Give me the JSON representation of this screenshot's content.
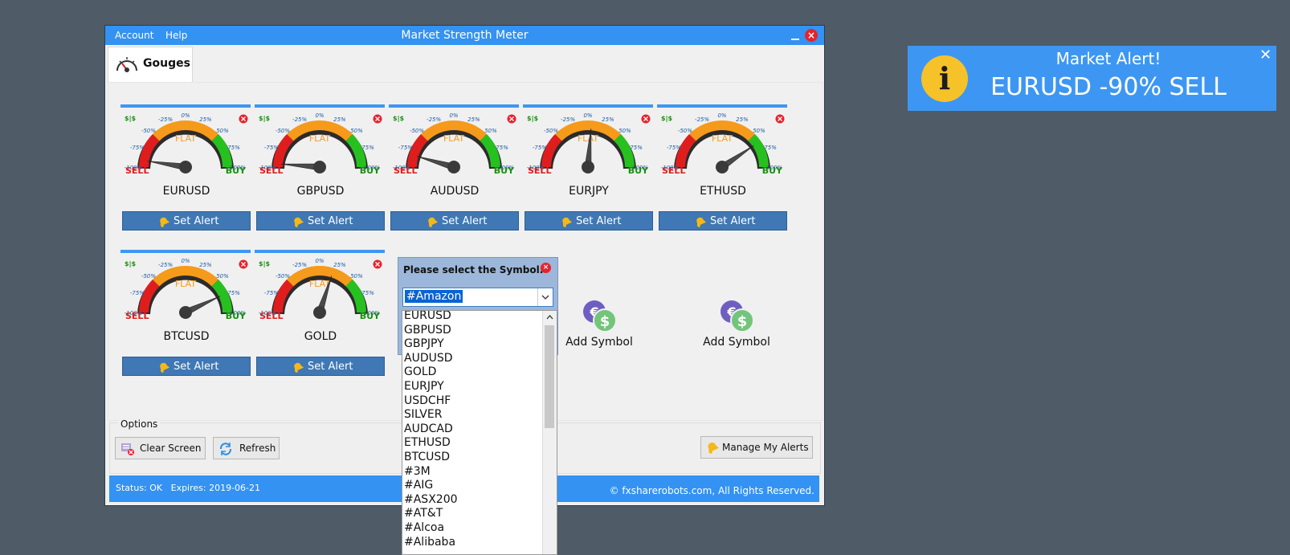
{
  "window": {
    "title": "Market Strength Meter",
    "menu": [
      "Account",
      "Help"
    ],
    "close_glyph": "×"
  },
  "tab": {
    "label": "Gouges",
    "icon": "gauge-icon"
  },
  "gauge_scale": {
    "ticks": [
      "-100%",
      "-75%",
      "-50%",
      "-25%",
      "0%",
      "25%",
      "50%",
      "75%",
      "100%"
    ],
    "sell": "SELL",
    "buy": "BUY",
    "flat": "FLAT",
    "dollar_tag": "$|$",
    "colors": {
      "sell": "#e01d1d",
      "flat": "#f59a1a",
      "buy": "#27c11f",
      "sell_text": "#e01d1d",
      "buy_text": "#19900e",
      "flat_text": "#f59a1a"
    }
  },
  "gauges": [
    {
      "symbol": "EURUSD",
      "strength": -90,
      "button": "Set Alert"
    },
    {
      "symbol": "GBPUSD",
      "strength": -95,
      "button": "Set Alert"
    },
    {
      "symbol": "AUDUSD",
      "strength": -82,
      "button": "Set Alert"
    },
    {
      "symbol": "EURJPY",
      "strength": 5,
      "button": "Set Alert"
    },
    {
      "symbol": "ETHUSD",
      "strength": 62,
      "button": "Set Alert"
    },
    {
      "symbol": "BTCUSD",
      "strength": 72,
      "button": "Set Alert"
    },
    {
      "symbol": "GOLD",
      "strength": 20,
      "button": "Set Alert"
    }
  ],
  "add_symbol": [
    {
      "label": "Add Symbol",
      "icon": "currency-exchange-icon"
    },
    {
      "label": "Add Symbol",
      "icon": "currency-exchange-icon"
    }
  ],
  "options": {
    "title": "Options",
    "clear_screen": "Clear Screen",
    "refresh": "Refresh",
    "manage_alerts": "Manage My Alerts"
  },
  "status": {
    "left": "Status: OK   Expires: 2019-06-21",
    "right": "© fxsharerobots.com, All Rights Reserved."
  },
  "symbol_picker": {
    "title": "Please select the Symbol:",
    "selected": "#Amazon",
    "options": [
      "EURUSD",
      "GBPUSD",
      "GBPJPY",
      "AUDUSD",
      "GOLD",
      "EURJPY",
      "USDCHF",
      "SILVER",
      "AUDCAD",
      "ETHUSD",
      "BTCUSD",
      "#3M",
      "#AIG",
      "#ASX200",
      "#AT&T",
      "#Alcoa",
      "#Alibaba"
    ]
  },
  "toast": {
    "title": "Market Alert!",
    "message": "EURUSD -90% SELL",
    "icon_glyph": "i",
    "close_glyph": "✕"
  }
}
